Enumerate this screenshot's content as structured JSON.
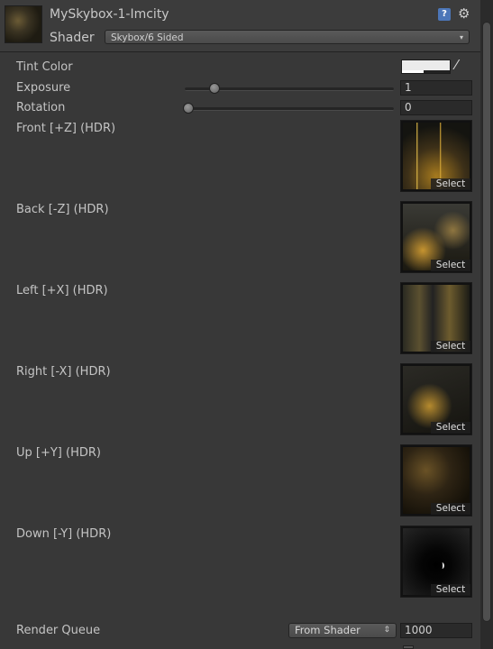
{
  "header": {
    "title": "MySkybox-1-Imcity",
    "shader_label": "Shader",
    "shader_value": "Skybox/6 Sided"
  },
  "properties": {
    "tint_color": {
      "label": "Tint Color",
      "color": "#ebebeb"
    },
    "exposure": {
      "label": "Exposure",
      "value": "1",
      "slider_fraction": 0.14
    },
    "rotation": {
      "label": "Rotation",
      "value": "0",
      "slider_fraction": 0.0
    }
  },
  "textures": [
    {
      "label": "Front [+Z]   (HDR)",
      "button": "Select"
    },
    {
      "label": "Back [-Z]   (HDR)",
      "button": "Select"
    },
    {
      "label": "Left [+X]   (HDR)",
      "button": "Select"
    },
    {
      "label": "Right [-X]   (HDR)",
      "button": "Select"
    },
    {
      "label": "Up [+Y]   (HDR)",
      "button": "Select"
    },
    {
      "label": "Down [-Y]   (HDR)",
      "button": "Select"
    }
  ],
  "render_queue": {
    "label": "Render Queue",
    "mode": "From Shader",
    "value": "1000"
  },
  "icons": [
    "help-icon",
    "gear-icon",
    "color-picker-icon",
    "dropdown-arrow-icon"
  ],
  "colors": {
    "background": "#383838",
    "accent_help": "#4c76b8"
  }
}
